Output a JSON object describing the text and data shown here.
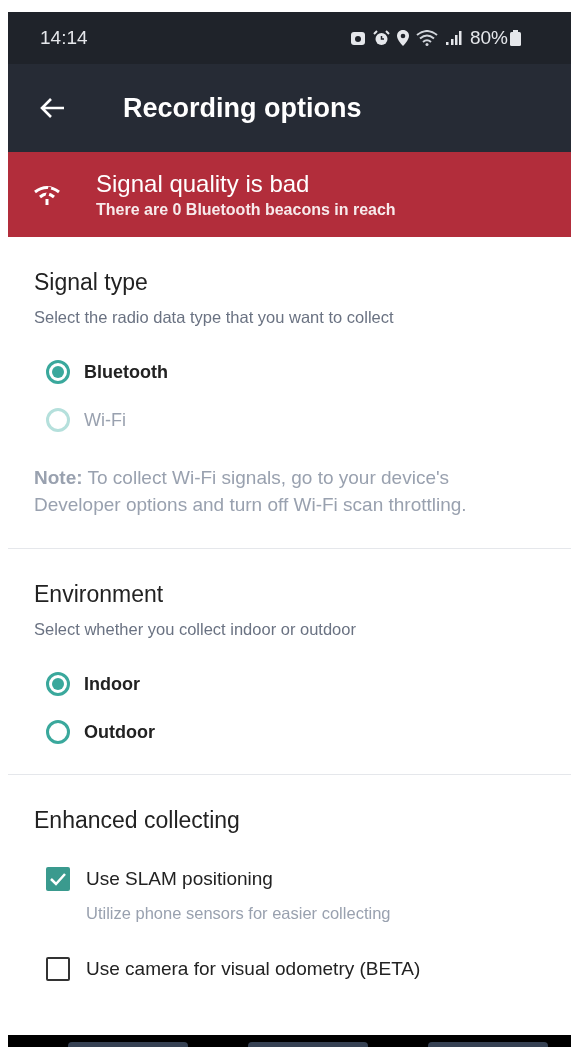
{
  "status_bar": {
    "time": "14:14",
    "battery": "80%"
  },
  "app_bar": {
    "title": "Recording options"
  },
  "banner": {
    "title": "Signal quality is bad",
    "message": "There are 0 Bluetooth beacons in reach"
  },
  "sections": [
    {
      "title": "Signal type",
      "subtitle": "Select the radio data type that you want to collect",
      "options": [
        {
          "kind": "radio",
          "label": "Bluetooth",
          "selected": true,
          "disabled": false
        },
        {
          "kind": "radio",
          "label": "Wi-Fi",
          "selected": false,
          "disabled": true
        }
      ],
      "note": "**Note:** To collect Wi-Fi signals, go to your device's Developer options and turn off Wi-Fi scan throttling."
    },
    {
      "title": "Environment",
      "subtitle": "Select whether you collect indoor or outdoor",
      "options": [
        {
          "kind": "radio",
          "label": "Indoor",
          "selected": true,
          "disabled": false
        },
        {
          "kind": "radio",
          "label": "Outdoor",
          "selected": false,
          "disabled": false
        }
      ]
    },
    {
      "title": "Enhanced collecting",
      "options": [
        {
          "kind": "checkbox",
          "label": "Use SLAM positioning",
          "checked": true,
          "description": "Utilize phone sensors for easier collecting"
        },
        {
          "kind": "checkbox",
          "label": "Use camera for visual odometry (BETA)",
          "checked": false
        }
      ]
    }
  ]
}
